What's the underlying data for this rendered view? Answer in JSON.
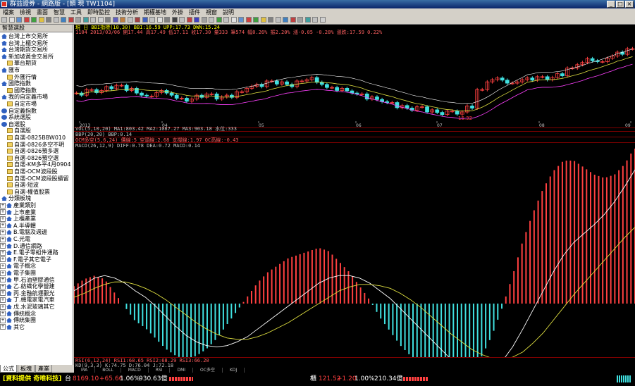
{
  "window": {
    "title": "群益證券 - 網路版 - [類 現 TW1104]",
    "buttons": [
      "_",
      "□",
      "×"
    ]
  },
  "menu": [
    "檔案",
    "檢視",
    "畫面",
    "智慧",
    "工具",
    "即時監控",
    "技術分析",
    "期權基地",
    "外掛",
    "插件",
    "視窗",
    "說明"
  ],
  "sidebar": {
    "header": "智慧選股",
    "items": [
      {
        "label": "台灣上市交易所",
        "icon": "home-icon",
        "level": 0
      },
      {
        "label": "台灣上櫃交易所",
        "icon": "home-icon",
        "level": 0
      },
      {
        "label": "台灣期貨交易所",
        "icon": "home-icon",
        "level": 0
      },
      {
        "label": "新加坡黃金交易所",
        "icon": "home-icon",
        "level": 0
      },
      {
        "label": "華台期貨",
        "icon": "folder-icon",
        "level": 1
      },
      {
        "label": "匯市",
        "icon": "home-icon",
        "level": 0
      },
      {
        "label": "外匯行情",
        "icon": "folder-icon",
        "level": 1
      },
      {
        "label": "國際指數",
        "icon": "home-icon",
        "level": 0
      },
      {
        "label": "國際指數",
        "icon": "folder-icon",
        "level": 1
      },
      {
        "label": "我的自定義市場",
        "icon": "home-icon",
        "level": 0
      },
      {
        "label": "自定市場",
        "icon": "folder-icon",
        "level": 1
      },
      {
        "label": "自定義指數",
        "icon": "dot-icon",
        "level": 0
      },
      {
        "label": "系統選股",
        "icon": "dot-icon",
        "level": 0
      },
      {
        "label": "自選股",
        "icon": "dot-icon",
        "level": 0
      },
      {
        "label": "自選股",
        "icon": "folder-icon",
        "level": 1
      },
      {
        "label": "自選-0825BBW010",
        "icon": "folder-icon",
        "level": 1
      },
      {
        "label": "自選-0826多空不明",
        "icon": "folder-icon",
        "level": 1
      },
      {
        "label": "自選-0826預多選",
        "icon": "folder-icon",
        "level": 1
      },
      {
        "label": "自選-0826預空選",
        "icon": "folder-icon",
        "level": 1
      },
      {
        "label": "自選-KM多平4月0904",
        "icon": "folder-icon",
        "level": 1
      },
      {
        "label": "自選-OCM波段股",
        "icon": "folder-icon",
        "level": 1
      },
      {
        "label": "自選-OCM波段股續留",
        "icon": "folder-icon",
        "level": 1
      },
      {
        "label": "自選-短波",
        "icon": "folder-icon",
        "level": 1
      },
      {
        "label": "自選-權值股票",
        "icon": "folder-icon",
        "level": 1
      },
      {
        "label": "分類板塊",
        "icon": "home-icon",
        "level": 0
      },
      {
        "label": "產業類別",
        "icon": "home-icon",
        "level": 1,
        "exp": "+"
      },
      {
        "label": "上市產業",
        "icon": "home-icon",
        "level": 1,
        "exp": "+"
      },
      {
        "label": "上櫃產業",
        "icon": "home-icon",
        "level": 1,
        "exp": "+"
      },
      {
        "label": "A.半導體",
        "icon": "home-icon",
        "level": 1,
        "exp": "+"
      },
      {
        "label": "B.電腦及週邊",
        "icon": "home-icon",
        "level": 1,
        "exp": "+"
      },
      {
        "label": "C.光電",
        "icon": "home-icon",
        "level": 1,
        "exp": "+"
      },
      {
        "label": "D.通信網路",
        "icon": "home-icon",
        "level": 1,
        "exp": "+"
      },
      {
        "label": "E.電子零組件通路",
        "icon": "home-icon",
        "level": 1,
        "exp": "+"
      },
      {
        "label": "F.電子其它電子",
        "icon": "home-icon",
        "level": 1,
        "exp": "+"
      },
      {
        "label": "電子概念",
        "icon": "home-icon",
        "level": 1,
        "exp": "+"
      },
      {
        "label": "電子集團",
        "icon": "home-icon",
        "level": 1,
        "exp": "+"
      },
      {
        "label": "甲.石油塑膠通信",
        "icon": "home-icon",
        "level": 1,
        "exp": "+"
      },
      {
        "label": "乙.紡織化學營建",
        "icon": "home-icon",
        "level": 1,
        "exp": "+"
      },
      {
        "label": "丙.金融航運觀光",
        "icon": "home-icon",
        "level": 1,
        "exp": "+"
      },
      {
        "label": "丁.機電家電汽車",
        "icon": "home-icon",
        "level": 1,
        "exp": "+"
      },
      {
        "label": "戊.水泥玻璃其它",
        "icon": "home-icon",
        "level": 1,
        "exp": "+"
      },
      {
        "label": "傳統概念",
        "icon": "home-icon",
        "level": 1,
        "exp": "+"
      },
      {
        "label": "傳統集團",
        "icon": "home-icon",
        "level": 1,
        "exp": "+"
      },
      {
        "label": "其它",
        "icon": "home-icon",
        "level": 1,
        "exp": "+"
      }
    ],
    "tabs": [
      "公式",
      "板塊",
      "產業"
    ]
  },
  "chart": {
    "header1": "現 日 BBI指標(10,30) BBI:16.59 UPP:17.73 DWN:15.24",
    "header2": "1104 2013/03/06 開17.44 高17.49 低17.11 收17.30 量333 筆574 幅0.26% 振2.20% 漲-0.05 -0.28% 漲跌:17.59 0.22%",
    "vol_header": "VOL(5,10,20) MA1:803.42 MA2:1087.27 MA3:903.18 水位:333",
    "bbp_header": "BBP(20,20) BBP:0.14",
    "ocm_header": "OCM多空(5,6,24) 價線:5 空頭線:2.68 支撐線:1.97 OC高線:-0.43",
    "macd_header": "MACD(26,12,9) DIFF:0.78 DEA:0.72 MACD:0.14",
    "rsi_header": "RSI(6,12,24) RSI1:68.65 RSI2:68.29 RSI3:66.20",
    "kd_header": "KD(9,3,3) K:74.75 D:76.04 J:72.18",
    "time_labels": [
      "2013",
      "04",
      "05",
      "06",
      "07",
      "08",
      "09"
    ],
    "price_label": "15.32",
    "bottom_tabs": [
      "MA",
      "BOLL",
      "MACD",
      "RSI",
      "DMI",
      "OC多空",
      "KDJ"
    ],
    "macd_diff": [
      0.1,
      0.15,
      0.2,
      0.22,
      0.2,
      0.16,
      0.1,
      0.05,
      -0.02,
      -0.1,
      -0.18,
      -0.25,
      -0.3,
      -0.33,
      -0.34,
      -0.33,
      -0.3,
      -0.26,
      -0.2,
      -0.14,
      -0.08,
      -0.02,
      0.04,
      0.1,
      0.16,
      0.2,
      0.22,
      0.22,
      0.2,
      0.16,
      0.1,
      0.04,
      -0.04,
      -0.12,
      -0.2,
      -0.28,
      -0.36,
      -0.44,
      -0.5,
      -0.54,
      -0.55,
      -0.52,
      -0.45,
      -0.34,
      -0.2,
      -0.05,
      0.1,
      0.25,
      0.38,
      0.48,
      0.55,
      0.62,
      0.7,
      0.8,
      0.92,
      1.05
    ],
    "macd_dea": [
      0.05,
      0.08,
      0.12,
      0.15,
      0.17,
      0.17,
      0.15,
      0.12,
      0.08,
      0.03,
      -0.03,
      -0.09,
      -0.15,
      -0.2,
      -0.24,
      -0.27,
      -0.28,
      -0.28,
      -0.26,
      -0.23,
      -0.19,
      -0.15,
      -0.1,
      -0.05,
      0.0,
      0.05,
      0.1,
      0.13,
      0.15,
      0.15,
      0.14,
      0.12,
      0.08,
      0.03,
      -0.03,
      -0.1,
      -0.17,
      -0.24,
      -0.3,
      -0.36,
      -0.4,
      -0.43,
      -0.44,
      -0.42,
      -0.38,
      -0.31,
      -0.23,
      -0.13,
      -0.03,
      0.07,
      0.16,
      0.25,
      0.34,
      0.43,
      0.52,
      0.6
    ],
    "price": [
      16.2,
      16.4,
      16.3,
      16.5,
      16.6,
      16.4,
      16.2,
      16.1,
      16.3,
      16.2,
      16.0,
      15.9,
      16.1,
      16.2,
      16.0,
      16.1,
      16.3,
      16.5,
      16.6,
      16.8,
      16.7,
      16.6,
      16.8,
      16.9,
      16.7,
      16.5,
      16.4,
      16.3,
      16.2,
      16.0,
      15.9,
      15.8,
      15.6,
      15.5,
      15.6,
      15.4,
      15.3,
      15.4,
      15.3,
      15.6,
      16.4,
      16.8,
      16.9,
      16.7,
      16.8,
      16.9,
      17.0,
      16.9,
      17.1,
      17.4,
      17.6,
      17.8,
      17.7,
      17.9,
      18.1,
      18.3
    ]
  },
  "status": {
    "source": "[資料提供 奇唯科技]",
    "taiex_label": "台",
    "taiex_value": "8169.10",
    "taiex_change": "+65.66",
    "taiex_pct": "1.06%",
    "taiex_amount": "930.63億",
    "otc_label": "櫃",
    "otc_value": "121.52",
    "otc_change": "+1.20",
    "otc_pct": "1.00%",
    "otc_amount": "210.34億"
  },
  "colors": {
    "up": "#ff4040",
    "down": "#40e0e0",
    "dif": "#ffffff",
    "dea": "#e0e040",
    "bbi": "#e0e040",
    "band": "#ff40ff"
  }
}
